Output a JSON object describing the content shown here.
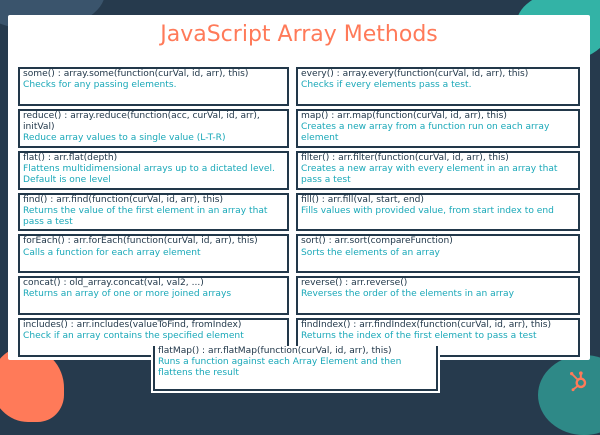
{
  "title": "JavaScript Array Methods",
  "colors": {
    "background": "#263a4d",
    "accent": "#ff7a59",
    "description": "#1aa8b8",
    "text": "#22384a",
    "teal": "#33b3a6"
  },
  "logo_icon": "hubspot-sprocket-icon",
  "methods": [
    {
      "sig": "some() : array.some(function(curVal, id, arr), this)",
      "desc": "Checks for any passing elements."
    },
    {
      "sig": "every() : array.every(function(curVal, id, arr), this)",
      "desc": "Checks if every elements pass a test."
    },
    {
      "sig": "reduce() : array.reduce(function(acc, curVal, id, arr), initVal)",
      "desc": "Reduce array values to a single value (L-T-R)"
    },
    {
      "sig": "map() : arr.map(function(curVal, id, arr), this)",
      "desc": "Creates a new array from a function run on each array element"
    },
    {
      "sig": "flat() : arr.flat(depth)",
      "desc": "Flattens multidimensional arrays up to a dictated level. Default is one level"
    },
    {
      "sig": "filter() : arr.filter(function(curVal, id, arr), this)",
      "desc": "Creates a new array with every element in an array that pass a test"
    },
    {
      "sig": "find() : arr.find(function(curVal, id, arr), this)",
      "desc": "Returns the value of the first element in an array that pass a test"
    },
    {
      "sig": "fill() : arr.fill(val, start, end)",
      "desc": "Fills values with provided value, from start index to end"
    },
    {
      "sig": "forEach() : arr.forEach(function(curVal, id, arr), this)",
      "desc": "Calls a function for each array element"
    },
    {
      "sig": "sort() : arr.sort(compareFunction)",
      "desc": "Sorts the elements of an array"
    },
    {
      "sig": "concat() : old_array.concat(val, val2, ...)",
      "desc": "Returns an array of one or more joined arrays"
    },
    {
      "sig": "reverse() : arr.reverse()",
      "desc": "Reverses the order of the elements in an array"
    },
    {
      "sig": "includes() : arr.includes(valueToFind, fromIndex)",
      "desc": "Check if an array contains the specified element"
    },
    {
      "sig": "findIndex() : arr.findIndex(function(curVal, id, arr), this)",
      "desc": "Returns the index of the first element to pass a test"
    },
    {
      "sig": "flatMap() : arr.flatMap(function(curVal, id, arr), this)",
      "desc": "Runs a function against each Array Element and then flattens the result"
    }
  ]
}
